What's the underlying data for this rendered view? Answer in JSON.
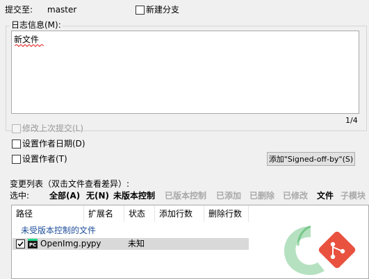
{
  "commit": {
    "commit_to_label": "提交至:",
    "branch": "master",
    "new_branch_label": "新建分支"
  },
  "log": {
    "group_label": "日志信息(M):",
    "message": "新文件",
    "counter": "1/4",
    "amend_label": "修改上次提交(L)",
    "set_author_date_label": "设置作者日期(D)",
    "set_author_label": "设置作者(T)",
    "signoff_button": "添加\"Signed-off-by\"(S)"
  },
  "changes": {
    "title": "变更列表（双击文件查看差异）:",
    "select_label": "选中:",
    "filters": [
      {
        "label": "全部(A)",
        "enabled": true
      },
      {
        "label": "无(N)",
        "enabled": true
      },
      {
        "label": "未版本控制",
        "enabled": true
      },
      {
        "label": "已版本控制",
        "enabled": false
      },
      {
        "label": "已添加",
        "enabled": false
      },
      {
        "label": "已删除",
        "enabled": false
      },
      {
        "label": "已修改",
        "enabled": false
      },
      {
        "label": "文件",
        "enabled": true
      },
      {
        "label": "子模块",
        "enabled": false
      }
    ],
    "columns": [
      "路径",
      "扩展名",
      "状态",
      "添加行数",
      "删除行数"
    ],
    "group_header": "未受版本控制的文件",
    "rows": [
      {
        "checked": true,
        "icon": "pycharm-file-icon",
        "path": "OpenImg.py",
        "ext": ".py",
        "status": "未知",
        "added": "",
        "deleted": ""
      }
    ]
  },
  "colors": {
    "window_bg": "#f0f0f0",
    "selection_bg": "#d9d9d9",
    "group_header_text": "#1f4e9a",
    "watermark_green": "#2aa84a",
    "watermark_red": "#e8523f"
  }
}
